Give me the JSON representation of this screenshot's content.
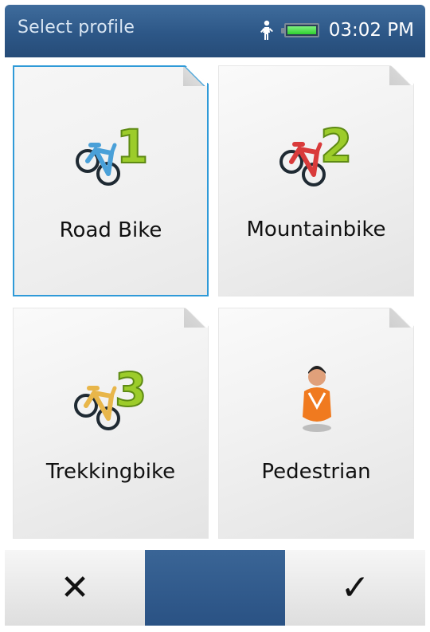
{
  "header": {
    "title": "Select profile",
    "time": "03:02 PM",
    "status_icons": [
      "pedestrian-icon",
      "battery-icon"
    ]
  },
  "profiles": [
    {
      "label": "Road Bike",
      "number": "1",
      "icon": "road-bike-icon",
      "selected": true
    },
    {
      "label": "Mountainbike",
      "number": "2",
      "icon": "mountain-bike-icon",
      "selected": false
    },
    {
      "label": "Trekkingbike",
      "number": "3",
      "icon": "trekking-bike-icon",
      "selected": false
    },
    {
      "label": "Pedestrian",
      "icon": "pedestrian-icon",
      "selected": false
    }
  ],
  "footer": {
    "cancel_icon": "close-icon",
    "confirm_icon": "check-icon",
    "cancel_symbol": "✕",
    "confirm_symbol": "✓"
  },
  "colors": {
    "header": "#2d5787",
    "selection_border": "#2f9ad8",
    "bike_road": "#4aa0d8",
    "bike_mountain": "#d93b3b",
    "bike_trekking": "#e8b64a",
    "number_green": "#9ccc2a"
  }
}
